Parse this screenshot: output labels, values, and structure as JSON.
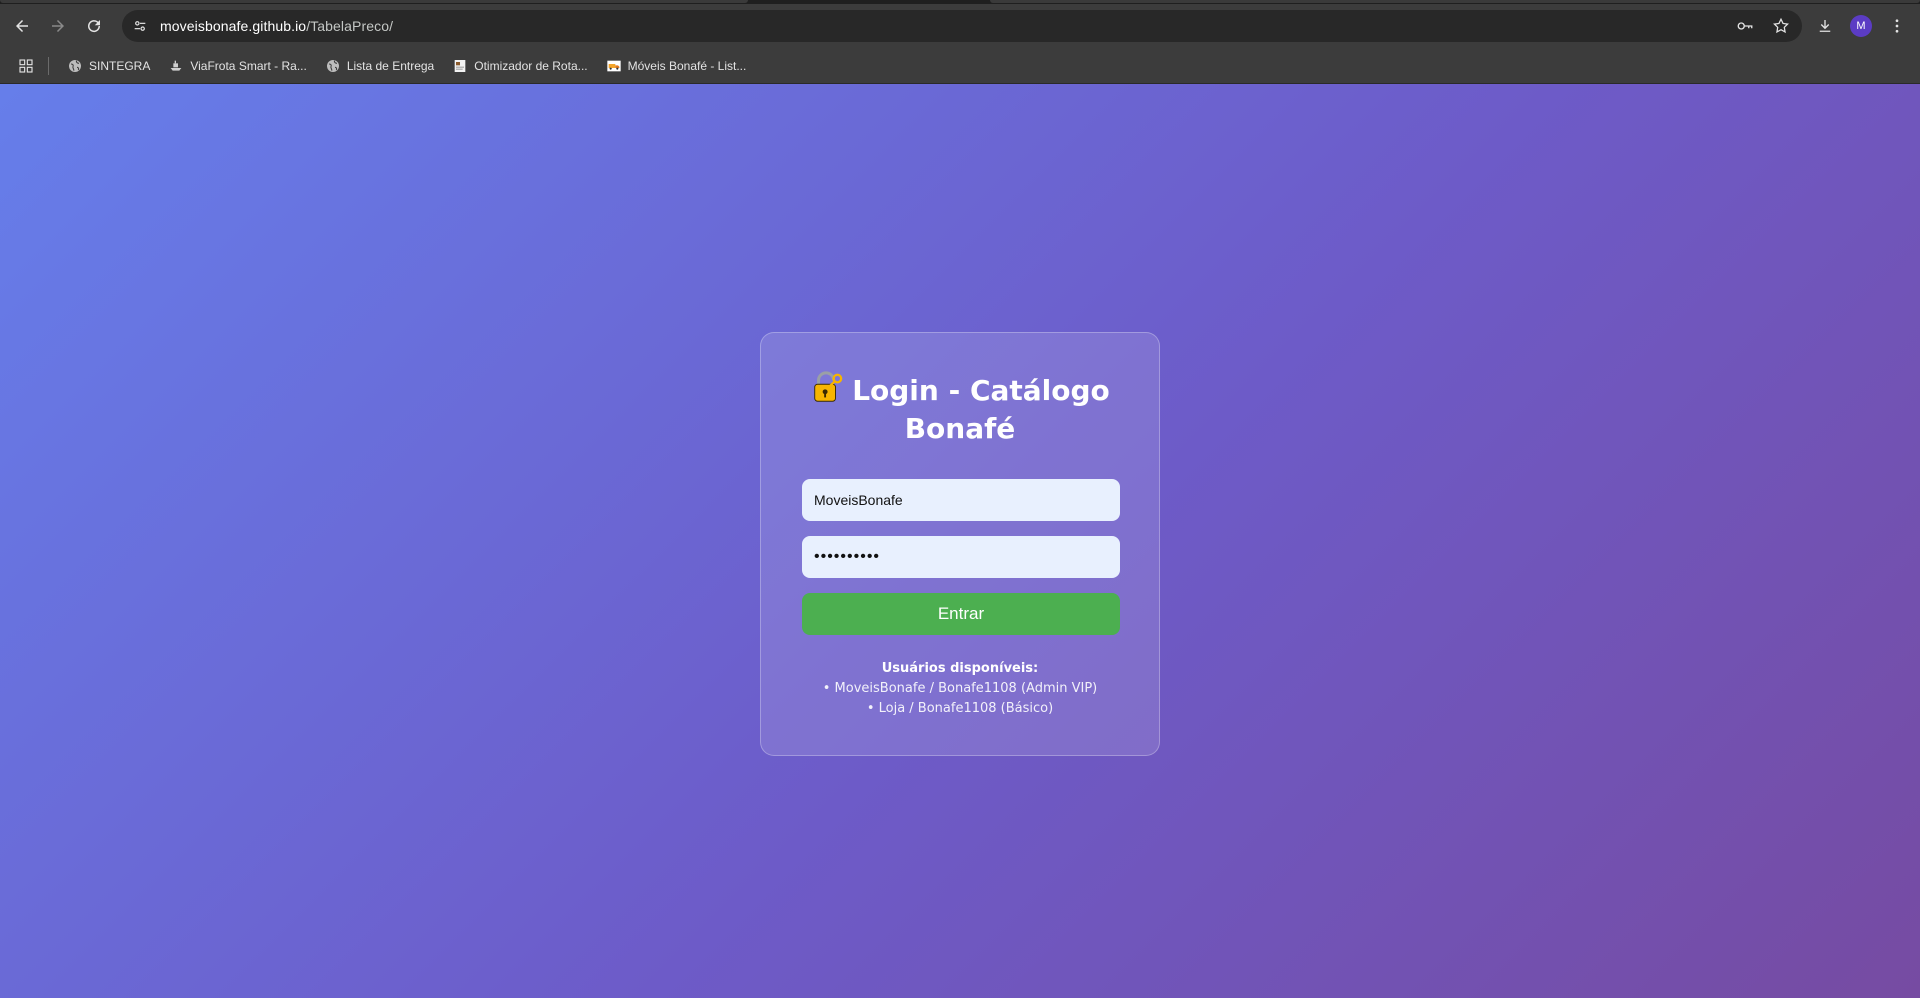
{
  "browser": {
    "url_host": "moveisbonafe.github.io",
    "url_path": "/TabelaPreco/",
    "avatar_letter": "M",
    "bookmarks": [
      {
        "label": "SINTEGRA",
        "icon": "globe-icon"
      },
      {
        "label": "ViaFrota Smart - Ra...",
        "icon": "ship-icon"
      },
      {
        "label": "Lista de Entrega",
        "icon": "globe-icon"
      },
      {
        "label": "Otimizador de Rota...",
        "icon": "document-icon"
      },
      {
        "label": "Móveis Bonafé - List...",
        "icon": "truck-icon"
      }
    ]
  },
  "login": {
    "title": "Login - Catálogo Bonafé",
    "title_icon": "lock-key-icon",
    "username_value": "MoveisBonafe",
    "password_value": "••••••••••",
    "submit_label": "Entrar",
    "users_heading": "Usuários disponíveis:",
    "users": [
      "• MoveisBonafe / Bonafe1108 (Admin VIP)",
      "• Loja / Bonafe1108 (Básico)"
    ]
  },
  "colors": {
    "gradient_start": "#667eea",
    "gradient_end": "#764ba2",
    "button": "#4caf50",
    "input_bg": "#e8f0fe"
  }
}
